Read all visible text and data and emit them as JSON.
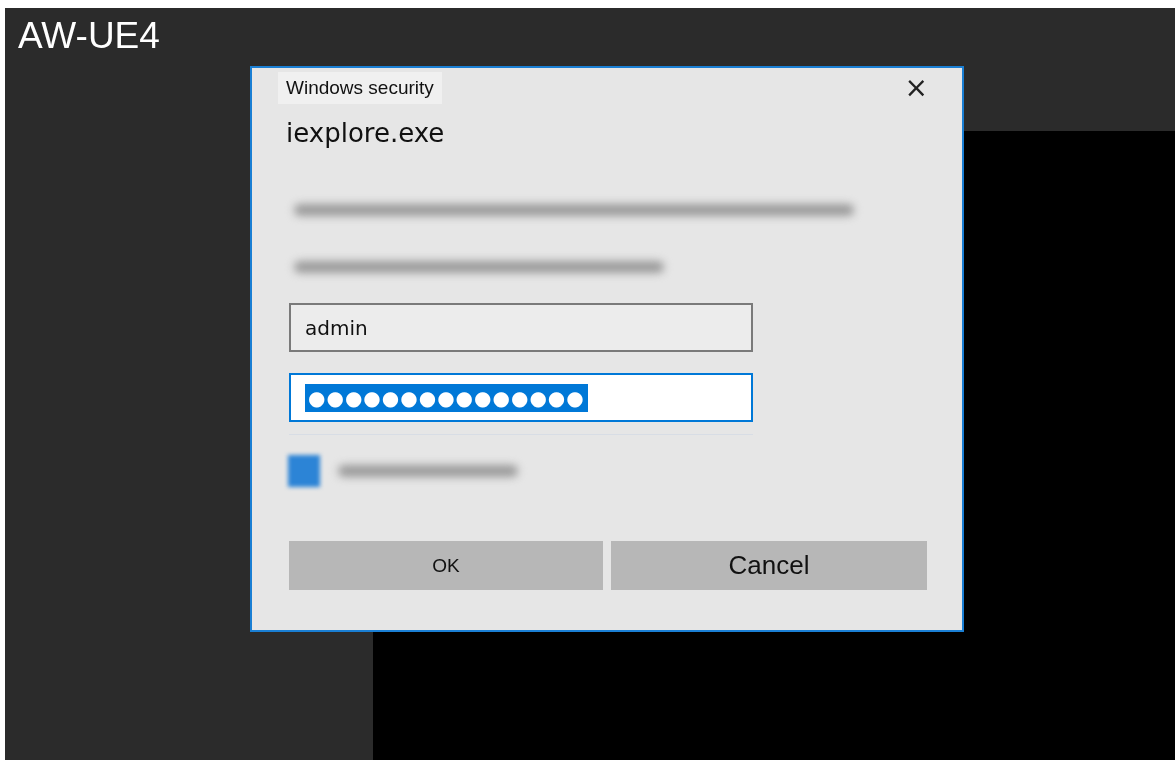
{
  "app": {
    "title": "AW-UE4"
  },
  "dialog": {
    "title": "Windows security",
    "close": "×",
    "app_name": "iexplore.exe",
    "username": {
      "value": "admin"
    },
    "password": {
      "value": "●●●●●●●●●●●●●●●",
      "text_selected": true
    },
    "remember_checkbox": {
      "checked": true
    },
    "buttons": [
      {
        "label": "OK"
      },
      {
        "label": "Cancel"
      }
    ]
  }
}
